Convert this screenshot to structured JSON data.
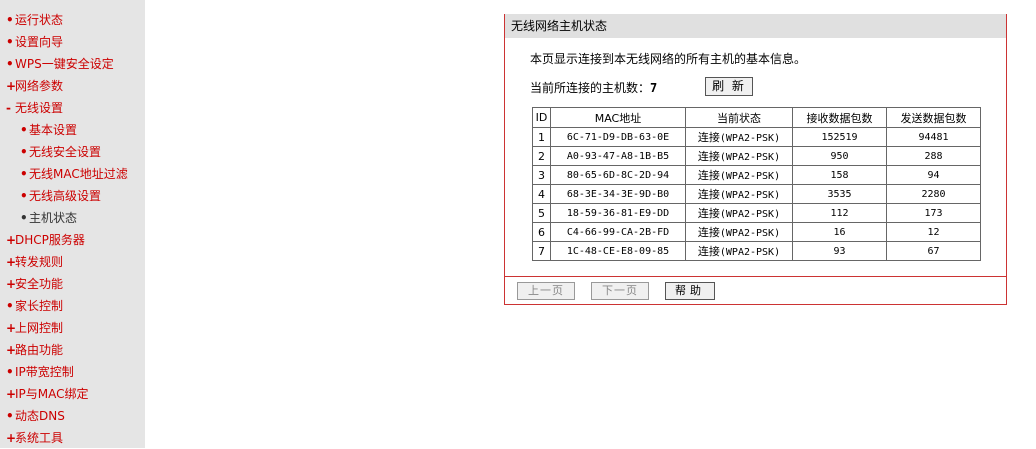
{
  "sidebar": {
    "items": [
      {
        "bullet": "•",
        "label": "运行状态"
      },
      {
        "bullet": "•",
        "label": "设置向导"
      },
      {
        "bullet": "•",
        "label": "WPS一键安全设定"
      },
      {
        "bullet": "+",
        "label": "网络参数"
      },
      {
        "bullet": "-",
        "label": "无线设置"
      },
      {
        "bullet": "•",
        "label": "基本设置"
      },
      {
        "bullet": "•",
        "label": "无线安全设置"
      },
      {
        "bullet": "•",
        "label": "无线MAC地址过滤"
      },
      {
        "bullet": "•",
        "label": "无线高级设置"
      },
      {
        "bullet": "•",
        "label": "主机状态"
      },
      {
        "bullet": "+",
        "label": "DHCP服务器"
      },
      {
        "bullet": "+",
        "label": "转发规则"
      },
      {
        "bullet": "+",
        "label": "安全功能"
      },
      {
        "bullet": "•",
        "label": "家长控制"
      },
      {
        "bullet": "+",
        "label": "上网控制"
      },
      {
        "bullet": "+",
        "label": "路由功能"
      },
      {
        "bullet": "•",
        "label": "IP带宽控制"
      },
      {
        "bullet": "+",
        "label": "IP与MAC绑定"
      },
      {
        "bullet": "•",
        "label": "动态DNS"
      },
      {
        "bullet": "+",
        "label": "系统工具"
      }
    ]
  },
  "panel": {
    "title": "无线网络主机状态",
    "description": "本页显示连接到本无线网络的所有主机的基本信息。",
    "count_label": "当前所连接的主机数：",
    "count_value": "7",
    "refresh_label": "刷 新"
  },
  "table": {
    "headers": [
      "ID",
      "MAC地址",
      "当前状态",
      "接收数据包数",
      "发送数据包数"
    ],
    "rows": [
      {
        "id": "1",
        "mac": "6C-71-D9-DB-63-0E",
        "state": "连接",
        "mode": "(WPA2-PSK)",
        "rx": "152519",
        "tx": "94481"
      },
      {
        "id": "2",
        "mac": "A0-93-47-A8-1B-B5",
        "state": "连接",
        "mode": "(WPA2-PSK)",
        "rx": "950",
        "tx": "288"
      },
      {
        "id": "3",
        "mac": "80-65-6D-8C-2D-94",
        "state": "连接",
        "mode": "(WPA2-PSK)",
        "rx": "158",
        "tx": "94"
      },
      {
        "id": "4",
        "mac": "68-3E-34-3E-9D-B0",
        "state": "连接",
        "mode": "(WPA2-PSK)",
        "rx": "3535",
        "tx": "2280"
      },
      {
        "id": "5",
        "mac": "18-59-36-81-E9-DD",
        "state": "连接",
        "mode": "(WPA2-PSK)",
        "rx": "112",
        "tx": "173"
      },
      {
        "id": "6",
        "mac": "C4-66-99-CA-2B-FD",
        "state": "连接",
        "mode": "(WPA2-PSK)",
        "rx": "16",
        "tx": "12"
      },
      {
        "id": "7",
        "mac": "1C-48-CE-E8-09-85",
        "state": "连接",
        "mode": "(WPA2-PSK)",
        "rx": "93",
        "tx": "67"
      }
    ]
  },
  "footer": {
    "prev_label": "上一页",
    "next_label": "下一页",
    "help_label": "帮助"
  },
  "colors": {
    "menu_red": "#cc0000",
    "panel_border": "#cc3333",
    "sidebar_bg": "#e5e5e5",
    "header_bg": "#e0e0e0"
  }
}
